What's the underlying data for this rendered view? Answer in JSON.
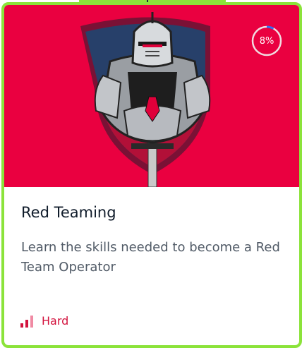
{
  "card": {
    "title": "Red Teaming",
    "description": "Learn the skills needed to become a Red Team Operator",
    "progress_percent": 8,
    "progress_label": "8%",
    "difficulty": {
      "label": "Hard",
      "level": 3,
      "max_level": 3,
      "icon": "signal-bars-icon"
    },
    "image_icon": "knight-shield-icon"
  },
  "colors": {
    "hero_background": "#ea0040",
    "border_accent": "#8be33a",
    "difficulty": "#d3133e",
    "progress_arc": "#2f6ef5"
  }
}
